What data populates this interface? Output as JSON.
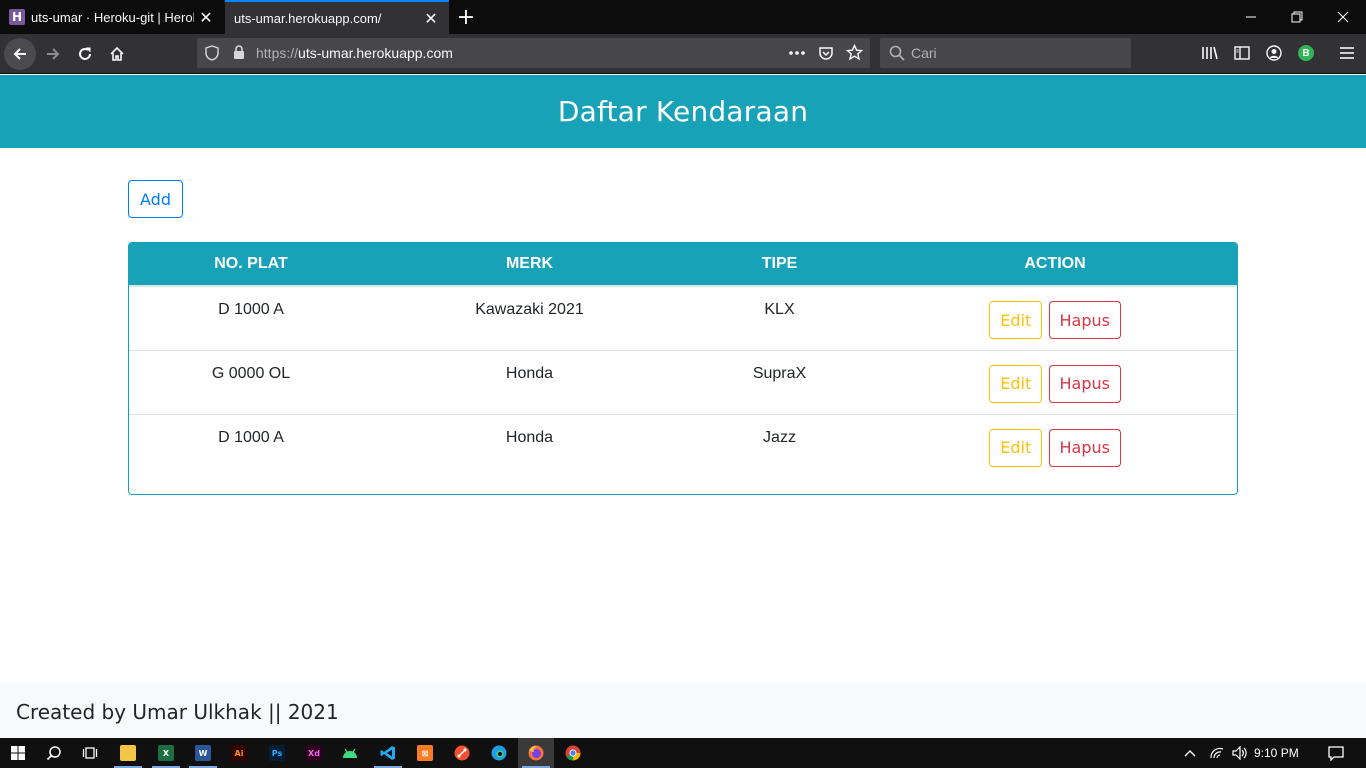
{
  "browser": {
    "tabs": [
      {
        "title": "uts-umar · Heroku-git | Heroku",
        "active": false,
        "favicon": "heroku-icon"
      },
      {
        "title": "uts-umar.herokuapp.com/",
        "active": true
      }
    ],
    "url_prefix": "https://",
    "url_host": "uts-umar.herokuapp.com",
    "search_placeholder": "Cari",
    "accent_color": "#0a84ff",
    "profile_initial": "B"
  },
  "page": {
    "header_title": "Daftar Kendaraan",
    "header_color": "#17a2b8",
    "add_label": "Add",
    "table": {
      "columns": [
        "NO. PLAT",
        "MERK",
        "TIPE",
        "ACTION"
      ],
      "rows": [
        {
          "plat": "D 1000 A",
          "merk": "Kawazaki 2021",
          "tipe": "KLX"
        },
        {
          "plat": "G 0000 OL",
          "merk": "Honda",
          "tipe": "SupraX"
        },
        {
          "plat": "D 1000 A",
          "merk": "Honda",
          "tipe": "Jazz"
        }
      ],
      "edit_label": "Edit",
      "delete_label": "Hapus"
    },
    "footer_text": "Created by Umar Ulkhak || 2021"
  },
  "taskbar": {
    "apps": [
      "file-explorer",
      "excel",
      "word",
      "illustrator",
      "photoshop",
      "xd",
      "android-studio",
      "vscode",
      "xampp",
      "git",
      "edge",
      "firefox",
      "chrome"
    ],
    "app_labels": {
      "illustrator": "Ai",
      "photoshop": "Ps",
      "xd": "Xd"
    },
    "clock": "9:10 PM"
  }
}
